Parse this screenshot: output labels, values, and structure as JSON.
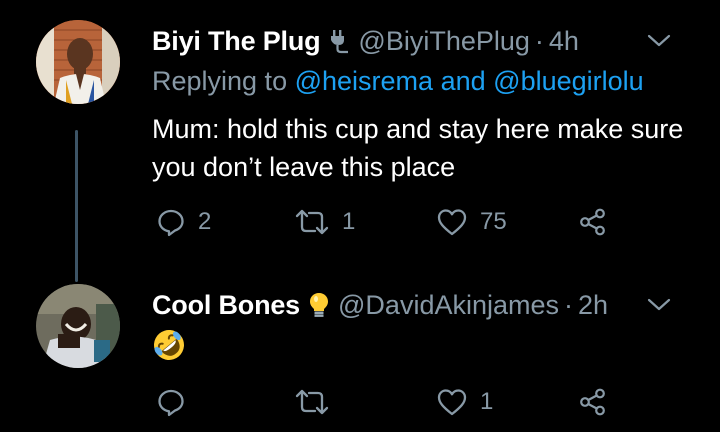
{
  "tweets": [
    {
      "author_name": "Biyi The Plug",
      "badge_icon": "plug-icon",
      "handle": "@BiyiThePlug",
      "separator": "·",
      "time": "4h",
      "replying_prefix": "Replying to",
      "mention_1": "@heisrema",
      "mention_joiner": "and",
      "mention_2": "@bluegirlolu",
      "text": "Mum: hold this cup and stay here make sure you don’t leave this place",
      "reply_count": "2",
      "retweet_count": "1",
      "like_count": "75",
      "share_count": ""
    },
    {
      "author_name": "Cool Bones",
      "badge_icon": "lightbulb-icon",
      "handle": "@DavidAkinjames",
      "separator": "·",
      "time": "2h",
      "body_emoji": "rolling-on-floor-laughing-emoji",
      "reply_count": "",
      "retweet_count": "",
      "like_count": "1",
      "share_count": ""
    }
  ],
  "colors": {
    "background": "#000000",
    "primary_text": "#ffffff",
    "secondary_text": "#8899a6",
    "link": "#1da1f2",
    "thread_line": "#3d5466"
  }
}
